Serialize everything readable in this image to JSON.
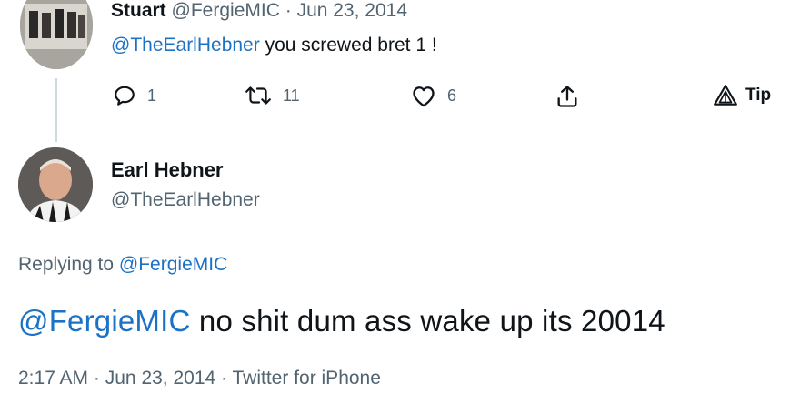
{
  "reply_tweet": {
    "author_name": "Stuart",
    "author_handle": "@FergieMIC",
    "separator": "·",
    "date": "Jun 23, 2014",
    "mention": "@TheEarlHebner",
    "text": " you screwed bret 1 !",
    "actions": {
      "reply_count": "1",
      "retweet_count": "11",
      "like_count": "6",
      "tip_label": "Tip"
    },
    "icons": [
      "reply-icon",
      "retweet-icon",
      "heart-icon",
      "share-icon",
      "tip-icon"
    ]
  },
  "main_tweet": {
    "author_name": "Earl Hebner",
    "author_handle": "@TheEarlHebner",
    "replying_prefix": "Replying to ",
    "replying_to": "@FergieMIC",
    "mention": "@FergieMIC",
    "text": " no shit dum ass wake up its 20014",
    "time": "2:17 AM",
    "date": "Jun 23, 2014",
    "source": "Twitter for iPhone",
    "separator": "·"
  },
  "colors": {
    "link": "#1d72c5",
    "muted": "#536471",
    "text": "#0f1419",
    "thread_line": "#cfd9de"
  }
}
